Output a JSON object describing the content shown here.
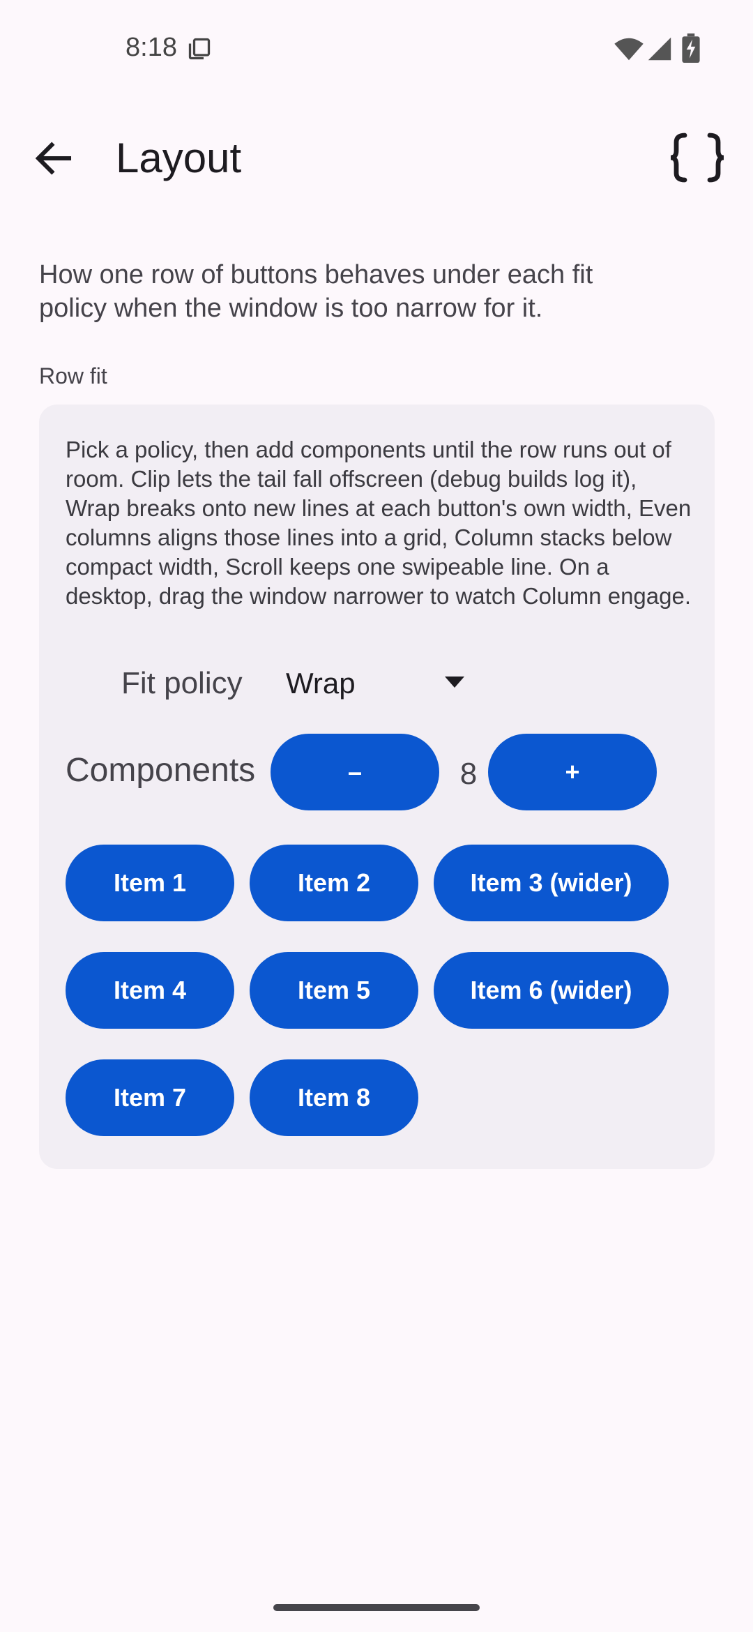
{
  "status_bar": {
    "time": "8:18",
    "icons": [
      "copy-icon",
      "wifi-icon",
      "signal-icon",
      "battery-charging-icon"
    ]
  },
  "app_bar": {
    "title": "Layout",
    "back_icon": "arrow-back-icon",
    "action_icon": "code-braces-icon"
  },
  "description": "How one row of buttons behaves under each fit policy when the window is too narrow for it.",
  "section_label": "Row fit",
  "card": {
    "text": "Pick a policy, then add components until the row runs out of room. Clip lets the tail fall offscreen (debug builds log it), Wrap breaks onto new lines at each button's own width, Even columns aligns those lines into a grid, Column stacks below compact width, Scroll keeps one swipeable line. On a desktop, drag the window narrower to watch Column engage.",
    "fit_policy": {
      "label": "Fit policy",
      "value": "Wrap"
    },
    "components": {
      "label": "Components",
      "decrement_label": "–",
      "count": "8",
      "increment_label": "+"
    },
    "items": [
      "Item 1",
      "Item 2",
      "Item 3 (wider)",
      "Item 4",
      "Item 5",
      "Item 6 (wider)",
      "Item 7",
      "Item 8"
    ]
  },
  "colors": {
    "background": "#FDF8FC",
    "card": "#F2EEF4",
    "primary_button": "#0B57D0",
    "on_primary": "#FFFFFF"
  }
}
